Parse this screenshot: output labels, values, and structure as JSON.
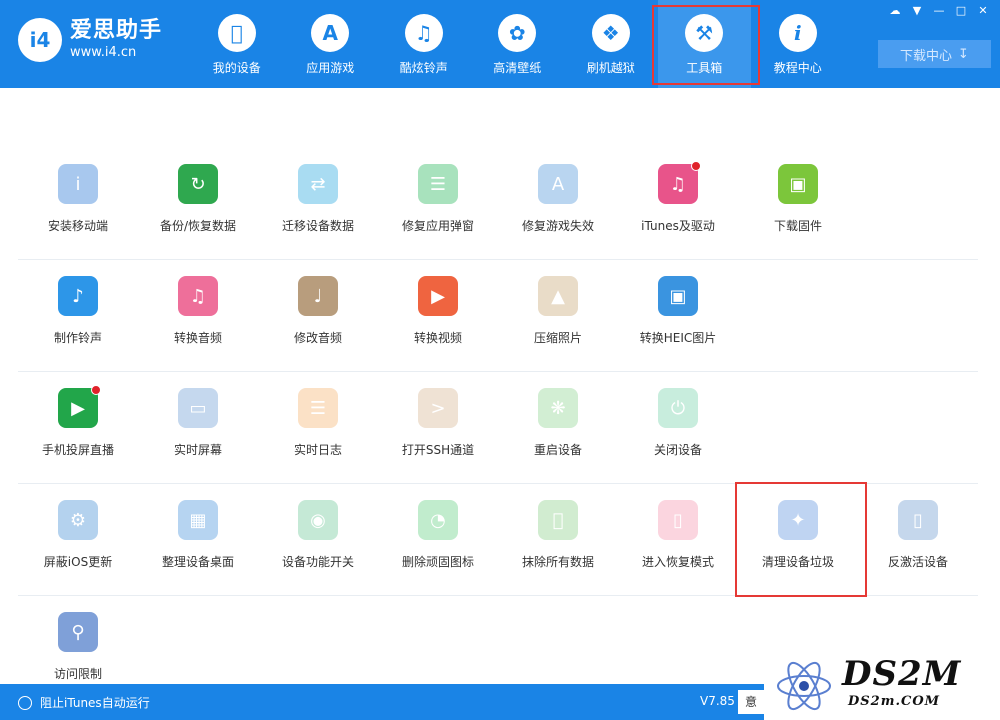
{
  "app": {
    "logo_mark": "i4",
    "name": "爱思助手",
    "url": "www.i4.cn"
  },
  "nav": [
    {
      "label": "我的设备",
      "icon": "apple-icon"
    },
    {
      "label": "应用游戏",
      "icon": "app-store-icon"
    },
    {
      "label": "酷炫铃声",
      "icon": "bell-icon"
    },
    {
      "label": "高清壁纸",
      "icon": "flower-icon"
    },
    {
      "label": "刷机越狱",
      "icon": "dropbox-icon"
    },
    {
      "label": "工具箱",
      "icon": "tools-icon",
      "active": true
    },
    {
      "label": "教程中心",
      "icon": "info-icon"
    }
  ],
  "download": {
    "label": "下载中心"
  },
  "tools": {
    "row1": [
      {
        "label": "安装移动端",
        "color": "#a8c8ee"
      },
      {
        "label": "备份/恢复数据",
        "color": "#2fa84f"
      },
      {
        "label": "迁移设备数据",
        "color": "#a9dcf2"
      },
      {
        "label": "修复应用弹窗",
        "color": "#a8e2bd"
      },
      {
        "label": "修复游戏失效",
        "color": "#b9d5f0"
      },
      {
        "label": "iTunes及驱动",
        "color": "#e8548a",
        "badge": true
      },
      {
        "label": "下载固件",
        "color": "#7cc63b"
      }
    ],
    "row2": [
      {
        "label": "制作铃声",
        "color": "#2d96e8"
      },
      {
        "label": "转换音频",
        "color": "#ee6f9a"
      },
      {
        "label": "修改音频",
        "color": "#b89d7d"
      },
      {
        "label": "转换视频",
        "color": "#ef6440"
      },
      {
        "label": "压缩照片",
        "color": "#e9dcc8"
      },
      {
        "label": "转换HEIC图片",
        "color": "#3a94e0"
      }
    ],
    "row3": [
      {
        "label": "手机投屏直播",
        "color": "#22a64a",
        "badge": true
      },
      {
        "label": "实时屏幕",
        "color": "#c5d8ee"
      },
      {
        "label": "实时日志",
        "color": "#fbe1c6"
      },
      {
        "label": "打开SSH通道",
        "color": "#efe2d4"
      },
      {
        "label": "重启设备",
        "color": "#d2eed3"
      },
      {
        "label": "关闭设备",
        "color": "#c8eddd"
      }
    ],
    "row4": [
      {
        "label": "屏蔽iOS更新",
        "color": "#b4d2ee"
      },
      {
        "label": "整理设备桌面",
        "color": "#b6d4f1"
      },
      {
        "label": "设备功能开关",
        "color": "#c5e9d6"
      },
      {
        "label": "删除顽固图标",
        "color": "#c1eccd"
      },
      {
        "label": "抹除所有数据",
        "color": "#d1ecd0"
      },
      {
        "label": "进入恢复模式",
        "color": "#fbd5df"
      },
      {
        "label": "清理设备垃圾",
        "color": "#bfd4f2",
        "highlight": true
      },
      {
        "label": "反激活设备",
        "color": "#c5d7ec"
      }
    ],
    "row5": [
      {
        "label": "访问限制",
        "color": "#7fa0d8"
      }
    ]
  },
  "footer": {
    "itunes_label": "阻止iTunes自动运行",
    "version": "V7.85",
    "version_suffix": "意"
  },
  "watermark": {
    "main": "DS2M",
    "sub": "DS2m.COM"
  }
}
